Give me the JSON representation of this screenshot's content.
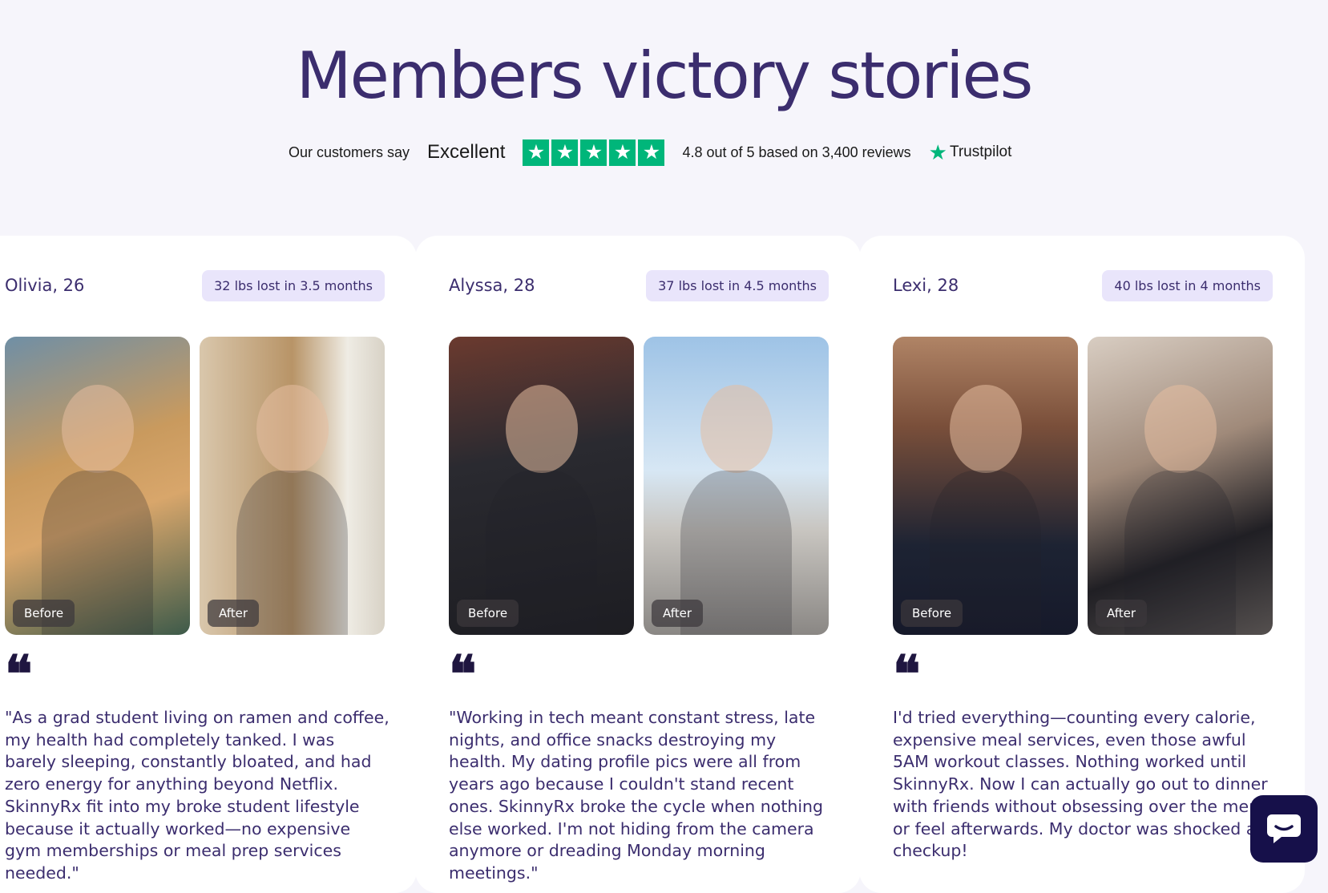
{
  "section": {
    "heading": "Members victory stories"
  },
  "trustpilot": {
    "customers_say": "Our customers say",
    "excellent": "Excellent",
    "stars": [
      "★",
      "★",
      "★",
      "★",
      "★"
    ],
    "rating_text": "4.8 out of 5 based on 3,400 reviews",
    "logo_star": "★",
    "logo_text": "Trustpilot",
    "star_color": "#00b67a"
  },
  "stories": [
    {
      "name": "Olivia, 26",
      "badge": "32 lbs lost in 3.5 months",
      "before_label": "Before",
      "after_label": "After",
      "quote_mark": "❝",
      "quote": "\"As a grad student living on ramen and coffee, my health had completely tanked. I was barely sleeping, constantly bloated, and had zero energy for anything beyond Netflix. SkinnyRx fit into my broke student lifestyle because it actually worked—no expensive gym memberships or meal prep services needed.\""
    },
    {
      "name": "Alyssa, 28",
      "badge": "37 lbs lost in 4.5 months",
      "before_label": "Before",
      "after_label": "After",
      "quote_mark": "❝",
      "quote": "\"Working in tech meant constant stress, late nights, and office snacks destroying my health. My dating profile pics were all from years ago because I couldn't stand recent ones. SkinnyRx broke the cycle when nothing else worked. I'm not hiding from the camera anymore or dreading Monday morning meetings.\""
    },
    {
      "name": "Lexi, 28",
      "badge": "40 lbs lost in 4 months",
      "before_label": "Before",
      "after_label": "After",
      "quote_mark": "❝",
      "quote": "I'd tried everything—counting every calorie, expensive meal services, even those awful 5AM workout classes. Nothing worked until SkinnyRx. Now I can actually go out to dinner with friends without obsessing over the menu or feel afterwards. My doctor was shocked at r checkup!"
    }
  ],
  "chat": {
    "icon": "chat-bubble-icon"
  },
  "colors": {
    "heading": "#3b2d6e",
    "badge_bg": "#e9e5fb",
    "page_bg": "#f6f5fb",
    "chat_bg": "#16104a"
  }
}
